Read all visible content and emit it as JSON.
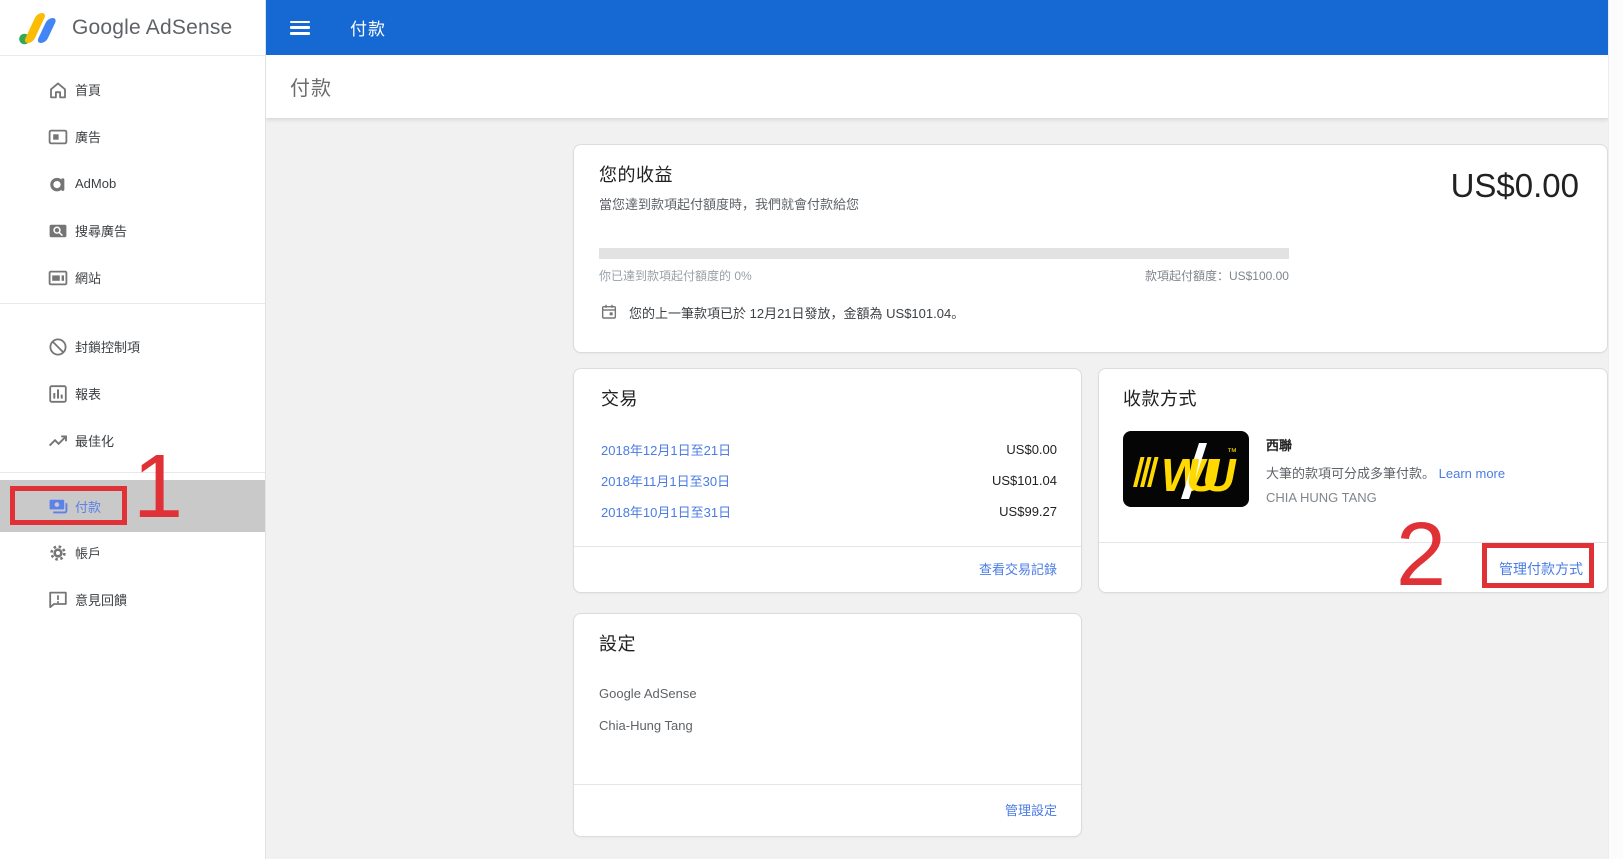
{
  "app": {
    "logo_text": "Google AdSense"
  },
  "header": {
    "title": "付款"
  },
  "subheader": {
    "title": "付款"
  },
  "sidebar": {
    "items": [
      {
        "label": "首頁",
        "icon": "home-icon",
        "selected": false
      },
      {
        "label": "廣告",
        "icon": "ads-icon",
        "selected": false
      },
      {
        "label": "AdMob",
        "icon": "admob-icon",
        "selected": false
      },
      {
        "label": "搜尋廣告",
        "icon": "search-ads-icon",
        "selected": false
      },
      {
        "label": "網站",
        "icon": "sites-icon",
        "selected": false
      },
      {
        "label": "封鎖控制項",
        "icon": "block-icon",
        "selected": false
      },
      {
        "label": "報表",
        "icon": "reports-icon",
        "selected": false
      },
      {
        "label": "最佳化",
        "icon": "trending-up-icon",
        "selected": false
      },
      {
        "label": "付款",
        "icon": "payments-icon",
        "selected": true
      },
      {
        "label": "帳戶",
        "icon": "gear-icon",
        "selected": false
      },
      {
        "label": "意見回饋",
        "icon": "feedback-icon",
        "selected": false
      }
    ]
  },
  "earnings_card": {
    "title": "您的收益",
    "subtitle": "當您達到款項起付額度時，我們就會付款給您",
    "balance": "US$0.00",
    "progress_percent": 0,
    "progress_label": "你已達到款項起付額度的 0%",
    "threshold_label": "款項起付額度：US$100.00",
    "last_payment": "您的上一筆款項已於 12月21日發放，金額為 US$101.04。"
  },
  "transactions_card": {
    "title": "交易",
    "rows": [
      {
        "period": "2018年12月1日至21日",
        "amount": "US$0.00"
      },
      {
        "period": "2018年11月1日至30日",
        "amount": "US$101.04"
      },
      {
        "period": "2018年10月1日至31日",
        "amount": "US$99.27"
      }
    ],
    "footer_link": "查看交易記錄"
  },
  "payment_method_card": {
    "title": "收款方式",
    "wu_logo_text": "WU",
    "wu_trademark": "™",
    "method_name": "西聯",
    "method_desc": "大筆的款項可分成多筆付款。",
    "learn_more_label": "Learn more",
    "payee": "CHIA HUNG TANG",
    "footer_link": "管理付款方式"
  },
  "settings_card": {
    "title": "設定",
    "items": [
      "Google AdSense",
      "Chia-Hung Tang"
    ],
    "footer_link": "管理設定"
  },
  "annotations": {
    "step1": "1",
    "step2": "2"
  },
  "colors": {
    "header_blue": "#1669d2",
    "link_blue": "#4b7ce3",
    "selected_blue": "#5b82ea",
    "annotation_red": "#e03236",
    "selected_row_gray": "#c9c9c9",
    "wu_yellow": "#ffd900",
    "wu_black": "#050505"
  }
}
